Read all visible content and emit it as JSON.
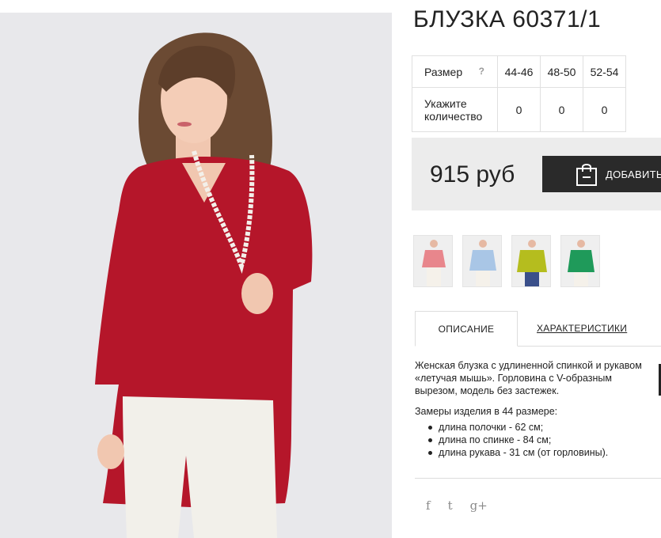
{
  "product": {
    "title": "БЛУЗКА 60371/1",
    "photo_alt": "model-in-red-blouse"
  },
  "size_table": {
    "size_label": "Размер",
    "help_symbol": "?",
    "sizes": [
      "44-46",
      "48-50",
      "52-54"
    ],
    "qty_label": "Укажите количество",
    "quantities": [
      "0",
      "0",
      "0"
    ]
  },
  "purchase": {
    "price": "915 руб",
    "add_button_label": "ДОБАВИТЬ"
  },
  "thumbnails": [
    {
      "color": "#e8868c"
    },
    {
      "color": "#a9c6e6"
    },
    {
      "color": "#b5bd1e"
    },
    {
      "color": "#1f9a5a"
    }
  ],
  "tabs": {
    "description": "ОПИСАНИЕ",
    "characteristics": "ХАРАКТЕРИСТИКИ"
  },
  "description": {
    "text": "Женская блузка с удлиненной спинкой и рукавом «летучая мышь». Горловина с V-образным вырезом, модель без застежек.",
    "measures_title": "Замеры изделия в 44 размере:",
    "measures": [
      "длина полочки - 62 см;",
      "длина по спинке - 84 см;",
      "длина рукава - 31 см (от горловины)."
    ]
  },
  "social": {
    "facebook": "f",
    "twitter": "t",
    "googleplus": "g+"
  },
  "colors": {
    "blouse": "#b5162a",
    "button_bg": "#2a2a2a",
    "price_bar_bg": "#ececec"
  }
}
